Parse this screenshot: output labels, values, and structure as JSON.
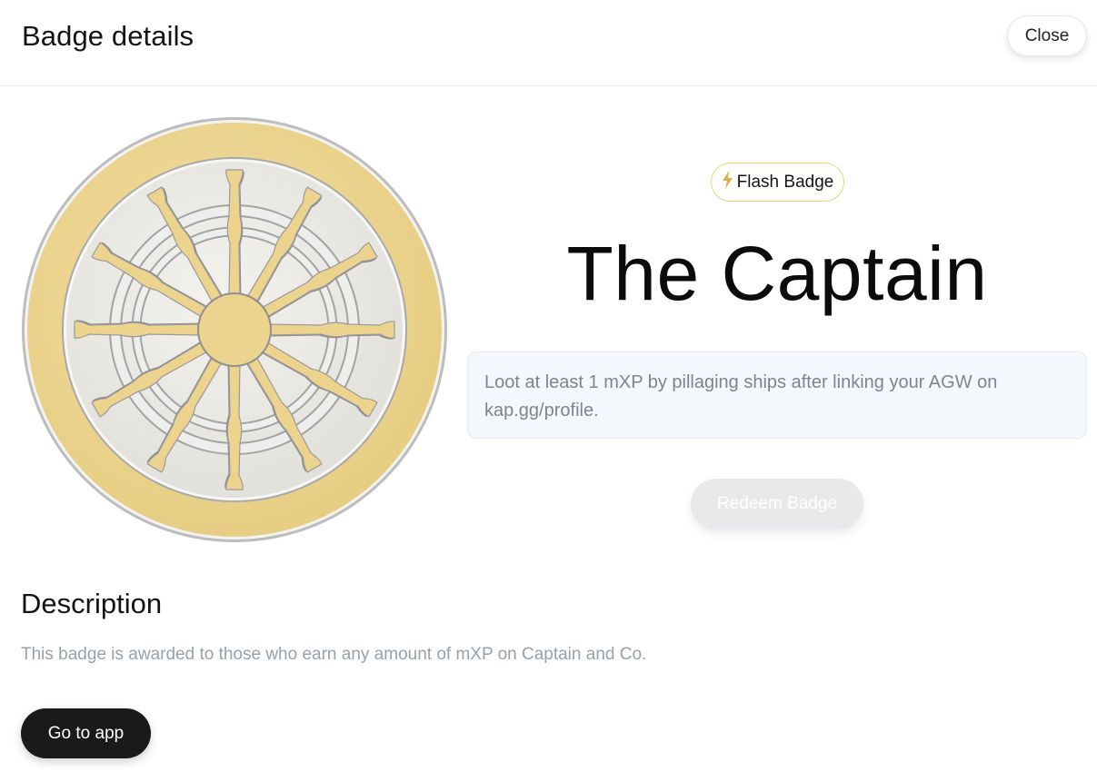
{
  "header": {
    "title": "Badge details",
    "close_label": "Close"
  },
  "badge": {
    "type_label": "Flash Badge",
    "type_icon": "lightning-bolt-icon",
    "name": "The Captain",
    "requirement": "Loot at least 1 mXP by pillaging ships after linking your AGW on kap.gg/profile.",
    "redeem_label": "Redeem Badge",
    "art_icon": "ship-wheel-icon"
  },
  "description": {
    "heading": "Description",
    "text": "This badge is awarded to those who earn any amount of mXP on Captain and Co."
  },
  "actions": {
    "go_label": "Go to app"
  },
  "colors": {
    "gold": "#ecd48e",
    "gold_border": "#ecd37a",
    "primary_button": "#1a1a1a",
    "disabled_button": "#e9e9ec"
  }
}
